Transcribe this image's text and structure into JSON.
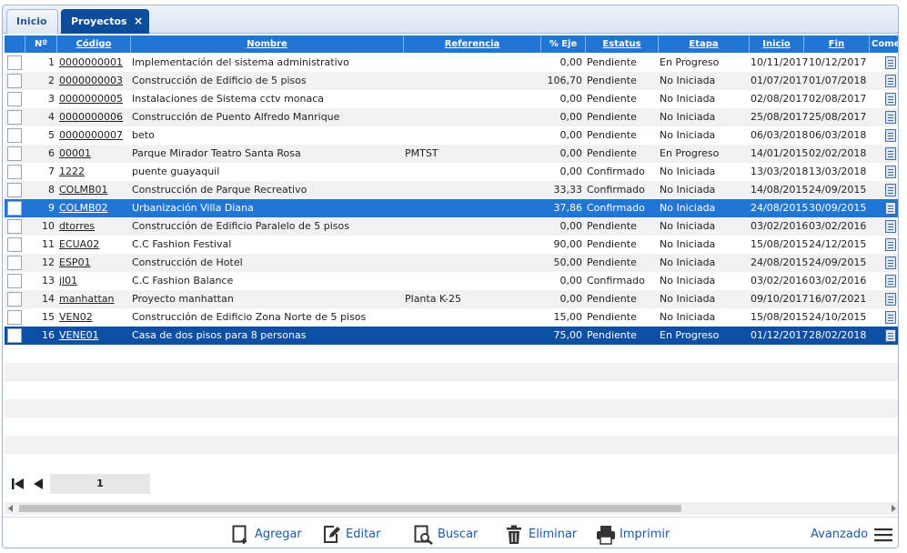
{
  "tabs": {
    "inicio": "Inicio",
    "proyectos": "Proyectos",
    "close_glyph": "×"
  },
  "columns": {
    "num": "Nº",
    "codigo": "Código",
    "nombre": "Nombre",
    "referencia": "Referencia",
    "eje": "% Eje",
    "estatus": "Estatus",
    "etapa": "Etapa",
    "inicio": "Inicio",
    "fin": "Fin",
    "comentarios": "Come"
  },
  "rows": [
    {
      "n": "1",
      "codigo": "0000000001",
      "nombre": "Implementación del sistema administrativo",
      "ref": "",
      "eje": "0,00",
      "estatus": "Pendiente",
      "etapa": "En Progreso",
      "inicio": "10/11/2017",
      "fin": "10/12/2017"
    },
    {
      "n": "2",
      "codigo": "0000000003",
      "nombre": "Construcción de Edificio de 5 pisos",
      "ref": "",
      "eje": "106,70",
      "estatus": "Pendiente",
      "etapa": "No Iniciada",
      "inicio": "01/07/2017",
      "fin": "01/07/2018"
    },
    {
      "n": "3",
      "codigo": "0000000005",
      "nombre": "Instalaciones de Sistema cctv monaca",
      "ref": "",
      "eje": "0,00",
      "estatus": "Pendiente",
      "etapa": "No Iniciada",
      "inicio": "02/08/2017",
      "fin": "02/08/2017"
    },
    {
      "n": "4",
      "codigo": "0000000006",
      "nombre": "Construcción de Puento Alfredo Manrique",
      "ref": "",
      "eje": "0,00",
      "estatus": "Pendiente",
      "etapa": "No Iniciada",
      "inicio": "25/08/2017",
      "fin": "25/08/2017"
    },
    {
      "n": "5",
      "codigo": "0000000007",
      "nombre": "beto",
      "ref": "",
      "eje": "0,00",
      "estatus": "Pendiente",
      "etapa": "No Iniciada",
      "inicio": "06/03/2018",
      "fin": "06/03/2018"
    },
    {
      "n": "6",
      "codigo": "00001",
      "nombre": "Parque Mirador Teatro Santa Rosa",
      "ref": "PMTST",
      "eje": "0,00",
      "estatus": "Pendiente",
      "etapa": "En Progreso",
      "inicio": "14/01/2015",
      "fin": "02/02/2018"
    },
    {
      "n": "7",
      "codigo": "1222",
      "nombre": "puente guayaquil",
      "ref": "",
      "eje": "0,00",
      "estatus": "Confirmado",
      "etapa": "No Iniciada",
      "inicio": "13/03/2018",
      "fin": "13/03/2018"
    },
    {
      "n": "8",
      "codigo": "COLMB01",
      "nombre": "Construcción de Parque Recreativo",
      "ref": "",
      "eje": "33,33",
      "estatus": "Confirmado",
      "etapa": "No Iniciada",
      "inicio": "14/08/2015",
      "fin": "24/09/2015"
    },
    {
      "n": "9",
      "codigo": "COLMB02",
      "nombre": "Urbanización Villa Diana",
      "ref": "",
      "eje": "37,86",
      "estatus": "Confirmado",
      "etapa": "No Iniciada",
      "inicio": "24/08/2015",
      "fin": "30/09/2015"
    },
    {
      "n": "10",
      "codigo": "dtorres",
      "nombre": "Construcción de Edificio Paralelo de 5 pisos",
      "ref": "",
      "eje": "0,00",
      "estatus": "Pendiente",
      "etapa": "No Iniciada",
      "inicio": "03/02/2016",
      "fin": "03/02/2016"
    },
    {
      "n": "11",
      "codigo": "ECUA02",
      "nombre": "C.C Fashion Festival",
      "ref": "",
      "eje": "90,00",
      "estatus": "Pendiente",
      "etapa": "No Iniciada",
      "inicio": "15/08/2015",
      "fin": "24/12/2015"
    },
    {
      "n": "12",
      "codigo": "ESP01",
      "nombre": "Construcción de Hotel",
      "ref": "",
      "eje": "50,00",
      "estatus": "Pendiente",
      "etapa": "No Iniciada",
      "inicio": "24/08/2015",
      "fin": "24/09/2015"
    },
    {
      "n": "13",
      "codigo": "jl01",
      "nombre": "C.C Fashion Balance",
      "ref": "",
      "eje": "0,00",
      "estatus": "Confirmado",
      "etapa": "No Iniciada",
      "inicio": "03/02/2016",
      "fin": "03/02/2016"
    },
    {
      "n": "14",
      "codigo": "manhattan",
      "nombre": "Proyecto manhattan",
      "ref": "Planta K-25",
      "eje": "0,00",
      "estatus": "Pendiente",
      "etapa": "No Iniciada",
      "inicio": "09/10/2017",
      "fin": "16/07/2021"
    },
    {
      "n": "15",
      "codigo": "VEN02",
      "nombre": "Construcción de Edificio Zona Norte de 5 pisos",
      "ref": "",
      "eje": "15,00",
      "estatus": "Pendiente",
      "etapa": "No Iniciada",
      "inicio": "15/08/2015",
      "fin": "24/10/2015"
    },
    {
      "n": "16",
      "codigo": "VENE01",
      "nombre": "Casa de dos pisos para 8 personas",
      "ref": "",
      "eje": "75,00",
      "estatus": "Pendiente",
      "etapa": "En Progreso",
      "inicio": "01/12/2017",
      "fin": "28/02/2018"
    }
  ],
  "pager": {
    "page": "1"
  },
  "toolbar": {
    "agregar": "Agregar",
    "editar": "Editar",
    "buscar": "Buscar",
    "eliminar": "Eliminar",
    "imprimir": "Imprimir",
    "avanzado": "Avanzado"
  },
  "colors": {
    "header": "#2176d3",
    "selected_row": "#2176d3",
    "active_row": "#0e4fa6",
    "link": "#1f5aa6"
  },
  "icons": [
    "close-icon",
    "comment-icon",
    "first-page-icon",
    "prev-page-icon",
    "add-icon",
    "edit-icon",
    "search-icon",
    "trash-icon",
    "printer-icon",
    "menu-icon"
  ]
}
